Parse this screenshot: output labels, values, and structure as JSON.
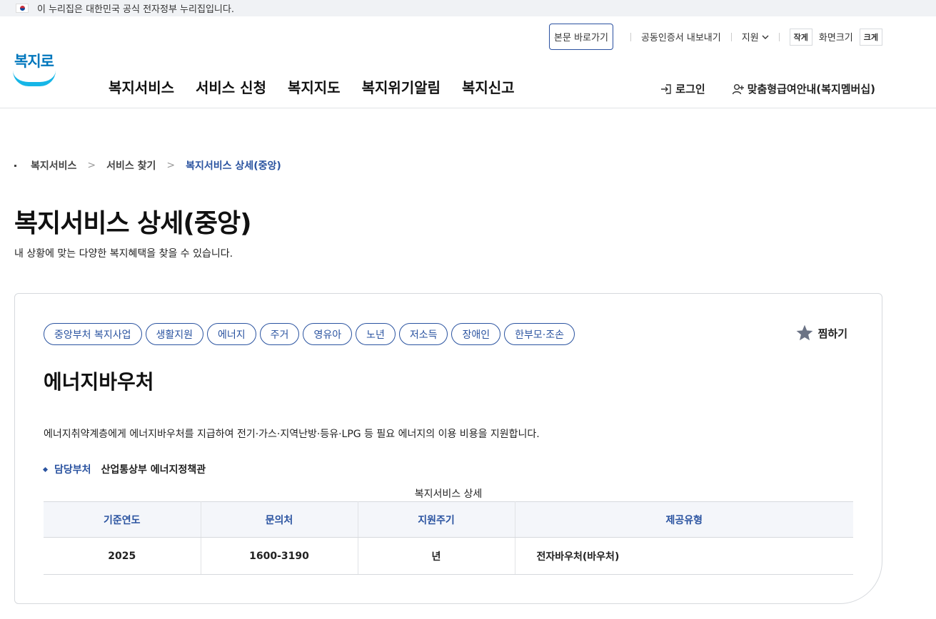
{
  "gov_banner": {
    "text": "이 누리집은 대한민국 공식 전자정부 누리집입니다."
  },
  "util": {
    "skip": "본문 바로가기",
    "cert_export": "공동인증서 내보내기",
    "lang": "지원",
    "font_small": "작게",
    "font_size_label": "화면크기",
    "font_large": "크게"
  },
  "logo": {
    "text": "복지로"
  },
  "gnb": [
    "복지서비스",
    "서비스 신청",
    "복지지도",
    "복지위기알림",
    "복지신고"
  ],
  "member": {
    "login": "로그인",
    "membership": "맞춤형급여안내(복지멤버십)"
  },
  "breadcrumb": [
    "복지서비스",
    "서비스 찾기",
    "복지서비스 상세(중앙)"
  ],
  "page": {
    "title": "복지서비스 상세(중앙)",
    "description": "내 상황에 맞는 다양한 복지혜택을 찾을 수 있습니다."
  },
  "service": {
    "tags": [
      "중앙부처 복지사업",
      "생활지원",
      "에너지",
      "주거",
      "영유아",
      "노년",
      "저소득",
      "장애인",
      "한부모·조손"
    ],
    "favorite": "찜하기",
    "title": "에너지바우처",
    "description": "에너지취약계층에게 에너지바우처를 지급하여 전기·가스·지역난방·등유·LPG 등 필요 에너지의 이용 비용을 지원합니다.",
    "dept_label": "담당부처",
    "dept_value": "산업통상부 에너지정책관",
    "table": {
      "caption": "복지서비스 상세",
      "headers": [
        "기준연도",
        "문의처",
        "지원주기",
        "제공유형"
      ],
      "row": [
        "2025",
        "1600-3190",
        "년",
        "전자바우처(바우처)"
      ]
    }
  },
  "colors": {
    "accent": "#2a53a0",
    "logo_blue": "#0077bd",
    "logo_smile": "#16b6e7"
  }
}
